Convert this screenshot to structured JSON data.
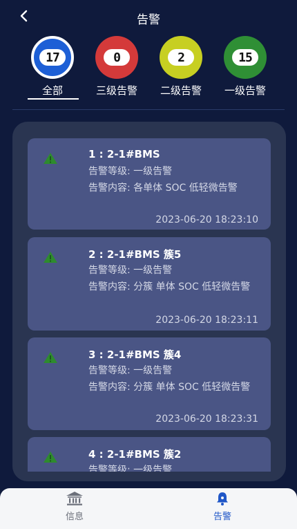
{
  "header": {
    "title": "告警",
    "back_icon": "chevron-left-icon"
  },
  "levels": [
    {
      "count": "17",
      "label": "全部",
      "color": "#1d5fd6",
      "selected": true
    },
    {
      "count": "0",
      "label": "三级告警",
      "color": "#d43a3a",
      "selected": false
    },
    {
      "count": "2",
      "label": "二级告警",
      "color": "#c7cf22",
      "selected": false
    },
    {
      "count": "15",
      "label": "一级告警",
      "color": "#2f8f35",
      "selected": false
    }
  ],
  "alarms": [
    {
      "title": "1 : 2-1#BMS",
      "level": "告警等级: 一级告警",
      "content": "告警内容: 各单体 SOC 低轻微告警",
      "time": "2023-06-20 18:23:10"
    },
    {
      "title": "2 : 2-1#BMS  簇5",
      "level": "告警等级: 一级告警",
      "content": "告警内容: 分簇 单体 SOC 低轻微告警",
      "time": "2023-06-20 18:23:11"
    },
    {
      "title": "3 : 2-1#BMS  簇4",
      "level": "告警等级: 一级告警",
      "content": "告警内容: 分簇 单体 SOC 低轻微告警",
      "time": "2023-06-20 18:23:31"
    },
    {
      "title": "4 : 2-1#BMS  簇2",
      "level": "告警等级: 一级告警",
      "content": "",
      "time": ""
    }
  ],
  "tabs": [
    {
      "label": "信息",
      "icon": "bank-icon",
      "active": false
    },
    {
      "label": "告警",
      "icon": "bell-icon",
      "active": true
    }
  ],
  "colors": {
    "background": "#0f1a3c",
    "panel": "#2a3551",
    "card": "#4a5585",
    "warning_icon": "#2e8b2e",
    "tab_active": "#1f56c7",
    "tab_inactive": "#6b6f7a"
  }
}
